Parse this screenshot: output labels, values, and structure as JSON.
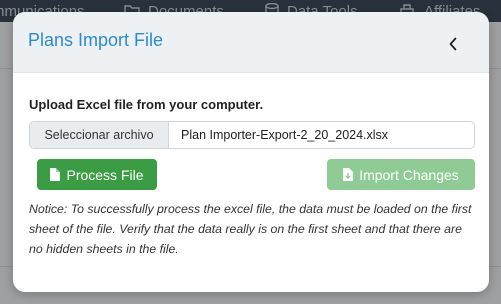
{
  "background": {
    "nav": {
      "items": [
        {
          "label": "mmunications",
          "icon": "none"
        },
        {
          "label": "Documents",
          "icon": "folder-icon"
        },
        {
          "label": "Data Tools",
          "icon": "database-icon"
        },
        {
          "label": "Affiliates",
          "icon": "building-icon"
        }
      ]
    }
  },
  "modal": {
    "title": "Plans Import File",
    "close_icon": "chevron-left-icon",
    "upload_label": "Upload Excel file from your computer.",
    "file_input": {
      "button_label": "Seleccionar archivo",
      "file_name": "Plan Importer-Export-2_20_2024.xlsx"
    },
    "buttons": {
      "process": {
        "label": "Process File",
        "icon": "file-icon",
        "color": "#3a9d44"
      },
      "import": {
        "label": "Import Changes",
        "icon": "file-import-icon",
        "color": "#8fcc95"
      }
    },
    "notice": "Notice: To successfully process the excel file, the data must be loaded on the first sheet of the file. Verify that the data really is on the first sheet and that there are no hidden sheets in the file."
  },
  "colors": {
    "title": "#2a8cd1",
    "nav_bg": "#1a2a3d"
  }
}
